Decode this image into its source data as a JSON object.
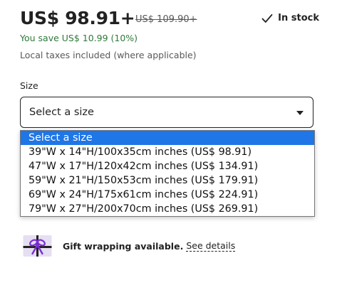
{
  "pricing": {
    "current_price": "US$ 98.91+",
    "original_price": "US$ 109.90+",
    "stock_status": "In stock",
    "savings": "You save US$ 10.99 (10%)",
    "tax_note": "Local taxes included (where applicable)"
  },
  "size": {
    "label": "Size",
    "selected_value": "Select a size",
    "options": [
      "Select a size",
      "39\"W x 14\"H/100x35cm inches (US$ 98.91)",
      "47\"W x 17\"H/120x42cm inches (US$ 134.91)",
      "59\"W x 21\"H/150x53cm inches (US$ 179.91)",
      "69\"W x 24\"H/175x61cm inches (US$ 224.91)",
      "79\"W x 27\"H/200x70cm inches (US$ 269.91)"
    ],
    "highlighted_index": 0
  },
  "gift": {
    "text": "Gift wrapping available.",
    "link": "See details"
  },
  "colors": {
    "savings_green": "#2f7a3a",
    "highlight_blue": "#1f76e6",
    "gift_purple": "#7b2fd1"
  },
  "icons": {
    "stock": "checkmark-icon",
    "gift": "gift-box-icon",
    "select": "caret-down-icon"
  }
}
